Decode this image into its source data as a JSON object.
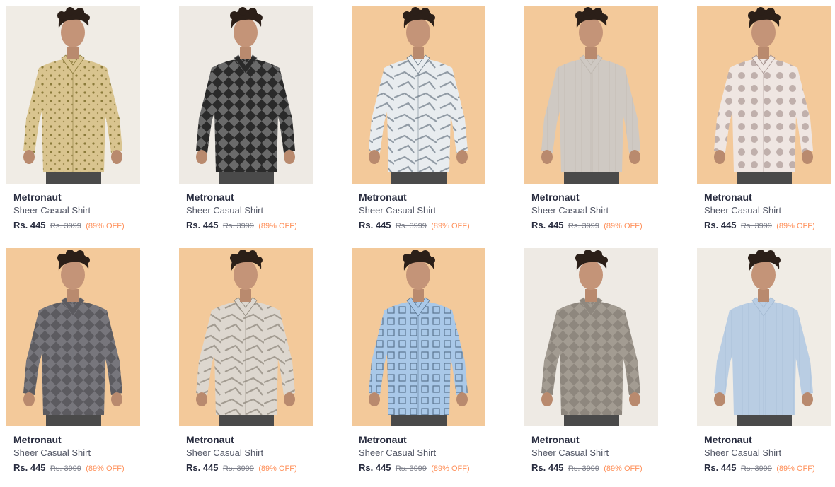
{
  "products": [
    {
      "brand": "Metronaut",
      "name": "Sheer Casual Shirt",
      "price": "Rs. 445",
      "mrp": "Rs. 3999",
      "discount": "(89% OFF)",
      "bg": "#f0ece5",
      "shirt": "#d9c48f",
      "pattern": "#8a7a3a",
      "style": "floral"
    },
    {
      "brand": "Metronaut",
      "name": "Sheer Casual Shirt",
      "price": "Rs. 445",
      "mrp": "Rs. 3999",
      "discount": "(89% OFF)",
      "bg": "#eeeae4",
      "shirt": "#2a2a2a",
      "pattern": "#6a6a6a",
      "style": "diamond"
    },
    {
      "brand": "Metronaut",
      "name": "Sheer Casual Shirt",
      "price": "Rs. 445",
      "mrp": "Rs. 3999",
      "discount": "(89% OFF)",
      "bg": "#f3c99a",
      "shirt": "#e8ecef",
      "pattern": "#6c7a86",
      "style": "abstract"
    },
    {
      "brand": "Metronaut",
      "name": "Sheer Casual Shirt",
      "price": "Rs. 445",
      "mrp": "Rs. 3999",
      "discount": "(89% OFF)",
      "bg": "#f3c99a",
      "shirt": "#cfc9c3",
      "pattern": "#bdb6ae",
      "style": "plain"
    },
    {
      "brand": "Metronaut",
      "name": "Sheer Casual Shirt",
      "price": "Rs. 445",
      "mrp": "Rs. 3999",
      "discount": "(89% OFF)",
      "bg": "#f3c99a",
      "shirt": "#efe6e2",
      "pattern": "#a08c88",
      "style": "dots"
    },
    {
      "brand": "Metronaut",
      "name": "Sheer Casual Shirt",
      "price": "Rs. 445",
      "mrp": "Rs. 3999",
      "discount": "(89% OFF)",
      "bg": "#f3c99a",
      "shirt": "#5c5b60",
      "pattern": "#77767c",
      "style": "diamond"
    },
    {
      "brand": "Metronaut",
      "name": "Sheer Casual Shirt",
      "price": "Rs. 445",
      "mrp": "Rs. 3999",
      "discount": "(89% OFF)",
      "bg": "#f3c99a",
      "shirt": "#ddd7cf",
      "pattern": "#8b8478",
      "style": "abstract"
    },
    {
      "brand": "Metronaut",
      "name": "Sheer Casual Shirt",
      "price": "Rs. 445",
      "mrp": "Rs. 3999",
      "discount": "(89% OFF)",
      "bg": "#f3c99a",
      "shirt": "#a9c8e8",
      "pattern": "#5a7590",
      "style": "squares"
    },
    {
      "brand": "Metronaut",
      "name": "Sheer Casual Shirt",
      "price": "Rs. 445",
      "mrp": "Rs. 3999",
      "discount": "(89% OFF)",
      "bg": "#eeeae4",
      "shirt": "#8e877e",
      "pattern": "#a39c92",
      "style": "diamond"
    },
    {
      "brand": "Metronaut",
      "name": "Sheer Casual Shirt",
      "price": "Rs. 445",
      "mrp": "Rs. 3999",
      "discount": "(89% OFF)",
      "bg": "#f0ece5",
      "shirt": "#b9cde3",
      "pattern": "#a4bad2",
      "style": "plain"
    }
  ]
}
